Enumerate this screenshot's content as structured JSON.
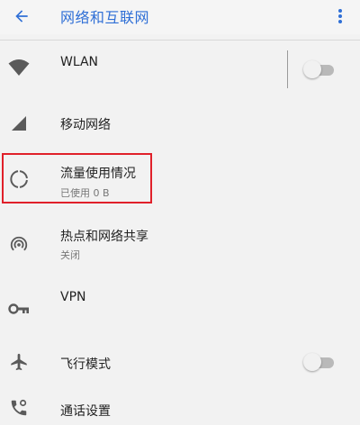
{
  "header": {
    "title": "网络和互联网",
    "back_icon": "arrow-left-icon",
    "more_icon": "more-vert-icon"
  },
  "colors": {
    "accent": "#2f6fd6",
    "icon_gray": "#5a5a5a",
    "highlight": "#e0202a",
    "background": "#f2f2f2"
  },
  "items": {
    "wlan": {
      "label": "WLAN",
      "icon": "wifi-icon",
      "toggle_on": false
    },
    "mobile": {
      "label": "移动网络",
      "icon": "signal-icon"
    },
    "data_usage": {
      "label": "流量使用情况",
      "subtitle": "已使用 0 B",
      "icon": "data-usage-icon"
    },
    "hotspot": {
      "label": "热点和网络共享",
      "subtitle": "关闭",
      "icon": "hotspot-icon"
    },
    "vpn": {
      "label": "VPN",
      "icon": "vpn-key-icon"
    },
    "airplane": {
      "label": "飞行模式",
      "icon": "airplane-icon",
      "toggle_on": false
    },
    "call": {
      "label": "通话设置",
      "icon": "phone-settings-icon"
    }
  }
}
